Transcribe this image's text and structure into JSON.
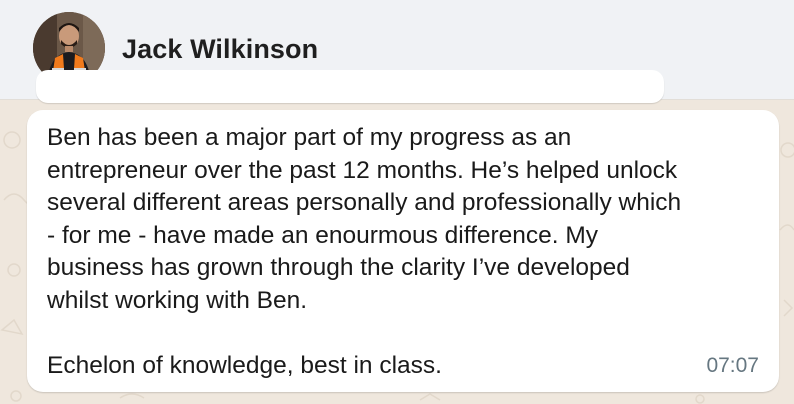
{
  "chat_header": {
    "contact_name": "Jack Wilkinson",
    "avatar_icon": "person-avatar-icon"
  },
  "message": {
    "text": "Ben has been a major part of my progress as an\nentrepreneur over the past 12 months. He’s helped unlock\nseveral different areas personally and professionally which\n- for me - have made an enourmous difference. My\nbusiness has grown through the clarity I’ve developed\nwhilst working with Ben.\n\nEchelon of knowledge, best in class.",
    "time": "07:07"
  },
  "colors": {
    "header_bg": "#f0f2f5",
    "chat_bg": "#efe7dd",
    "bubble_bg": "#ffffff",
    "time_color": "#667781"
  }
}
